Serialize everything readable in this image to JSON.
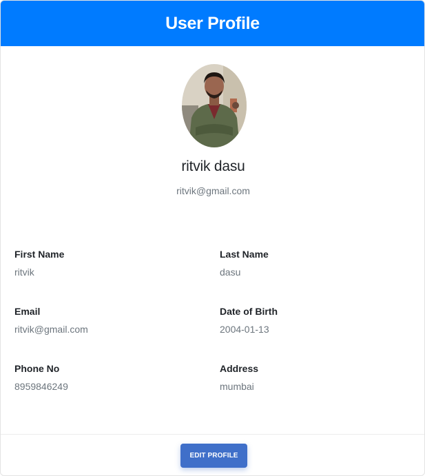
{
  "header": {
    "title": "User Profile"
  },
  "profile": {
    "name": "ritvik dasu",
    "email": "ritvik@gmail.com",
    "avatar_icon": "user-photo"
  },
  "fields": {
    "first_name": {
      "label": "First Name",
      "value": "ritvik"
    },
    "last_name": {
      "label": "Last Name",
      "value": "dasu"
    },
    "email": {
      "label": "Email",
      "value": "ritvik@gmail.com"
    },
    "dob": {
      "label": "Date of Birth",
      "value": "2004-01-13"
    },
    "phone": {
      "label": "Phone No",
      "value": "8959846249"
    },
    "address": {
      "label": "Address",
      "value": "mumbai"
    }
  },
  "actions": {
    "edit_label": "EDIT PROFILE"
  },
  "colors": {
    "header_bg": "#007bff",
    "button_bg": "#3f6fc9",
    "label_text": "#1f2328",
    "muted_text": "#6c757d"
  }
}
